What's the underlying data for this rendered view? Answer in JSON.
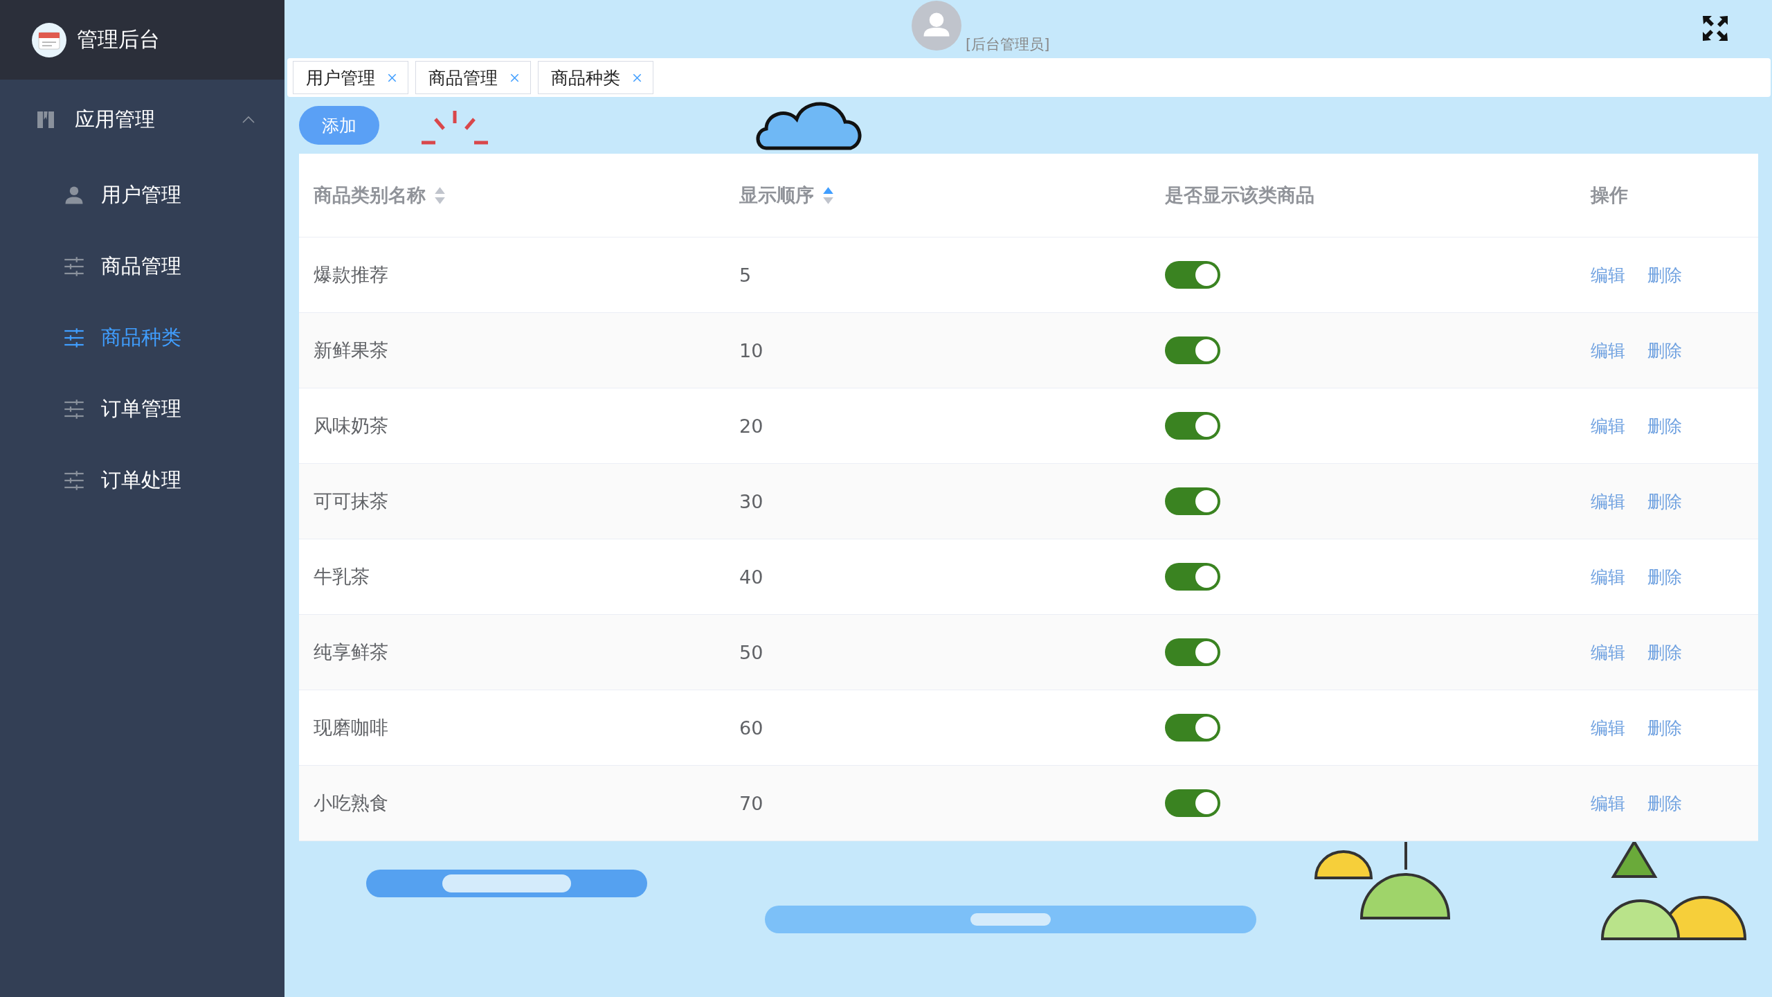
{
  "sidebar": {
    "title": "管理后台",
    "group": {
      "label": "应用管理",
      "expanded": true
    },
    "items": [
      {
        "label": "用户管理",
        "kind": "user",
        "selected": false
      },
      {
        "label": "商品管理",
        "kind": "sliders",
        "selected": false
      },
      {
        "label": "商品种类",
        "kind": "sliders",
        "selected": true
      },
      {
        "label": "订单管理",
        "kind": "sliders",
        "selected": false
      },
      {
        "label": "订单处理",
        "kind": "sliders",
        "selected": false
      }
    ]
  },
  "header": {
    "user_role": "[后台管理员]"
  },
  "tabs": [
    {
      "label": "用户管理"
    },
    {
      "label": "商品管理"
    },
    {
      "label": "商品种类"
    }
  ],
  "add_button": "添加",
  "table": {
    "columns": [
      {
        "label": "商品类别名称",
        "sort_asc": false,
        "sort_desc": false
      },
      {
        "label": "显示顺序",
        "sort_asc": true,
        "sort_desc": false
      },
      {
        "label": "是否显示该类商品"
      },
      {
        "label": "操作"
      }
    ],
    "rows": [
      {
        "name": "爆款推荐",
        "order": "5",
        "shown": true,
        "actions": [
          "编辑",
          "删除"
        ]
      },
      {
        "name": "新鲜果茶",
        "order": "10",
        "shown": true,
        "actions": [
          "编辑",
          "删除"
        ]
      },
      {
        "name": "风味奶茶",
        "order": "20",
        "shown": true,
        "actions": [
          "编辑",
          "删除"
        ]
      },
      {
        "name": "可可抹茶",
        "order": "30",
        "shown": true,
        "actions": [
          "编辑",
          "删除"
        ]
      },
      {
        "name": "牛乳茶",
        "order": "40",
        "shown": true,
        "actions": [
          "编辑",
          "删除"
        ]
      },
      {
        "name": "纯享鲜茶",
        "order": "50",
        "shown": true,
        "actions": [
          "编辑",
          "删除"
        ]
      },
      {
        "name": "现磨咖啡",
        "order": "60",
        "shown": true,
        "actions": [
          "编辑",
          "删除"
        ]
      },
      {
        "name": "小吃熟食",
        "order": "70",
        "shown": true,
        "actions": [
          "编辑",
          "删除"
        ]
      }
    ]
  }
}
